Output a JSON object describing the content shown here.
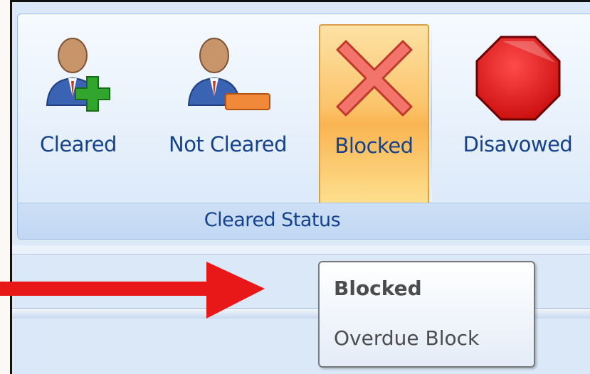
{
  "ribbon": {
    "group_label": "Cleared Status",
    "buttons": [
      {
        "label": "Cleared",
        "icon": "user-add-icon",
        "active": false
      },
      {
        "label": "Not Cleared",
        "icon": "user-remove-icon",
        "active": false
      },
      {
        "label": "Blocked",
        "icon": "red-x-icon",
        "active": true
      },
      {
        "label": "Disavowed",
        "icon": "stop-sign-icon",
        "active": false
      }
    ]
  },
  "tooltip": {
    "title": "Blocked",
    "description": "Overdue Block"
  },
  "annotation": {
    "arrow_color": "#e81818"
  },
  "colors": {
    "label_text": "#15428b",
    "active_fill": "#f9b451",
    "tooltip_text": "#4c4c4c"
  }
}
